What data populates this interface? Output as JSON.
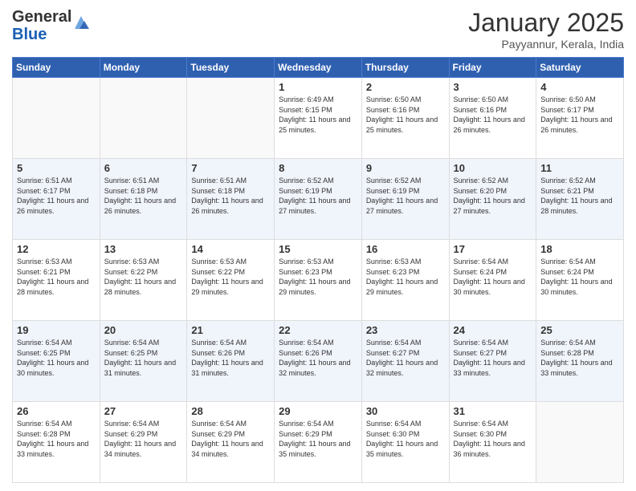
{
  "header": {
    "logo": {
      "general": "General",
      "blue": "Blue"
    },
    "title": "January 2025",
    "location": "Payyannur, Kerala, India"
  },
  "days_header": [
    "Sunday",
    "Monday",
    "Tuesday",
    "Wednesday",
    "Thursday",
    "Friday",
    "Saturday"
  ],
  "weeks": [
    [
      {
        "num": "",
        "info": ""
      },
      {
        "num": "",
        "info": ""
      },
      {
        "num": "",
        "info": ""
      },
      {
        "num": "1",
        "info": "Sunrise: 6:49 AM\nSunset: 6:15 PM\nDaylight: 11 hours and 25 minutes."
      },
      {
        "num": "2",
        "info": "Sunrise: 6:50 AM\nSunset: 6:16 PM\nDaylight: 11 hours and 25 minutes."
      },
      {
        "num": "3",
        "info": "Sunrise: 6:50 AM\nSunset: 6:16 PM\nDaylight: 11 hours and 26 minutes."
      },
      {
        "num": "4",
        "info": "Sunrise: 6:50 AM\nSunset: 6:17 PM\nDaylight: 11 hours and 26 minutes."
      }
    ],
    [
      {
        "num": "5",
        "info": "Sunrise: 6:51 AM\nSunset: 6:17 PM\nDaylight: 11 hours and 26 minutes."
      },
      {
        "num": "6",
        "info": "Sunrise: 6:51 AM\nSunset: 6:18 PM\nDaylight: 11 hours and 26 minutes."
      },
      {
        "num": "7",
        "info": "Sunrise: 6:51 AM\nSunset: 6:18 PM\nDaylight: 11 hours and 26 minutes."
      },
      {
        "num": "8",
        "info": "Sunrise: 6:52 AM\nSunset: 6:19 PM\nDaylight: 11 hours and 27 minutes."
      },
      {
        "num": "9",
        "info": "Sunrise: 6:52 AM\nSunset: 6:19 PM\nDaylight: 11 hours and 27 minutes."
      },
      {
        "num": "10",
        "info": "Sunrise: 6:52 AM\nSunset: 6:20 PM\nDaylight: 11 hours and 27 minutes."
      },
      {
        "num": "11",
        "info": "Sunrise: 6:52 AM\nSunset: 6:21 PM\nDaylight: 11 hours and 28 minutes."
      }
    ],
    [
      {
        "num": "12",
        "info": "Sunrise: 6:53 AM\nSunset: 6:21 PM\nDaylight: 11 hours and 28 minutes."
      },
      {
        "num": "13",
        "info": "Sunrise: 6:53 AM\nSunset: 6:22 PM\nDaylight: 11 hours and 28 minutes."
      },
      {
        "num": "14",
        "info": "Sunrise: 6:53 AM\nSunset: 6:22 PM\nDaylight: 11 hours and 29 minutes."
      },
      {
        "num": "15",
        "info": "Sunrise: 6:53 AM\nSunset: 6:23 PM\nDaylight: 11 hours and 29 minutes."
      },
      {
        "num": "16",
        "info": "Sunrise: 6:53 AM\nSunset: 6:23 PM\nDaylight: 11 hours and 29 minutes."
      },
      {
        "num": "17",
        "info": "Sunrise: 6:54 AM\nSunset: 6:24 PM\nDaylight: 11 hours and 30 minutes."
      },
      {
        "num": "18",
        "info": "Sunrise: 6:54 AM\nSunset: 6:24 PM\nDaylight: 11 hours and 30 minutes."
      }
    ],
    [
      {
        "num": "19",
        "info": "Sunrise: 6:54 AM\nSunset: 6:25 PM\nDaylight: 11 hours and 30 minutes."
      },
      {
        "num": "20",
        "info": "Sunrise: 6:54 AM\nSunset: 6:25 PM\nDaylight: 11 hours and 31 minutes."
      },
      {
        "num": "21",
        "info": "Sunrise: 6:54 AM\nSunset: 6:26 PM\nDaylight: 11 hours and 31 minutes."
      },
      {
        "num": "22",
        "info": "Sunrise: 6:54 AM\nSunset: 6:26 PM\nDaylight: 11 hours and 32 minutes."
      },
      {
        "num": "23",
        "info": "Sunrise: 6:54 AM\nSunset: 6:27 PM\nDaylight: 11 hours and 32 minutes."
      },
      {
        "num": "24",
        "info": "Sunrise: 6:54 AM\nSunset: 6:27 PM\nDaylight: 11 hours and 33 minutes."
      },
      {
        "num": "25",
        "info": "Sunrise: 6:54 AM\nSunset: 6:28 PM\nDaylight: 11 hours and 33 minutes."
      }
    ],
    [
      {
        "num": "26",
        "info": "Sunrise: 6:54 AM\nSunset: 6:28 PM\nDaylight: 11 hours and 33 minutes."
      },
      {
        "num": "27",
        "info": "Sunrise: 6:54 AM\nSunset: 6:29 PM\nDaylight: 11 hours and 34 minutes."
      },
      {
        "num": "28",
        "info": "Sunrise: 6:54 AM\nSunset: 6:29 PM\nDaylight: 11 hours and 34 minutes."
      },
      {
        "num": "29",
        "info": "Sunrise: 6:54 AM\nSunset: 6:29 PM\nDaylight: 11 hours and 35 minutes."
      },
      {
        "num": "30",
        "info": "Sunrise: 6:54 AM\nSunset: 6:30 PM\nDaylight: 11 hours and 35 minutes."
      },
      {
        "num": "31",
        "info": "Sunrise: 6:54 AM\nSunset: 6:30 PM\nDaylight: 11 hours and 36 minutes."
      },
      {
        "num": "",
        "info": ""
      }
    ]
  ]
}
